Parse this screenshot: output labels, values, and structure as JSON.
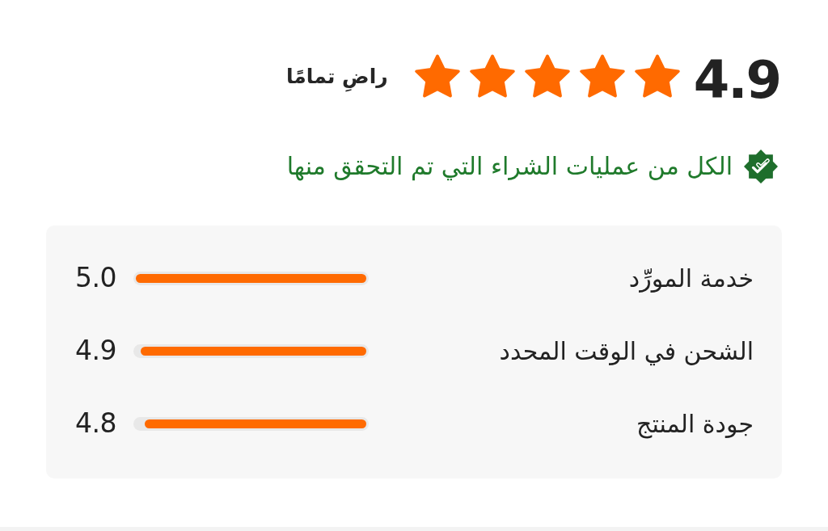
{
  "rating": {
    "score": "4.9",
    "stars": 5,
    "verdict": "راضِ تمامًا"
  },
  "verified_note": "الكل من عمليات الشراء التي تم التحقق منها",
  "breakdown": [
    {
      "label": "خدمة المورِّد",
      "level": 1.0,
      "reading": "5.0"
    },
    {
      "label": "الشحن في الوقت المحدد",
      "level": 0.98,
      "reading": "4.9"
    },
    {
      "label": "جودة المنتج",
      "level": 0.96,
      "reading": "4.8"
    }
  ]
}
